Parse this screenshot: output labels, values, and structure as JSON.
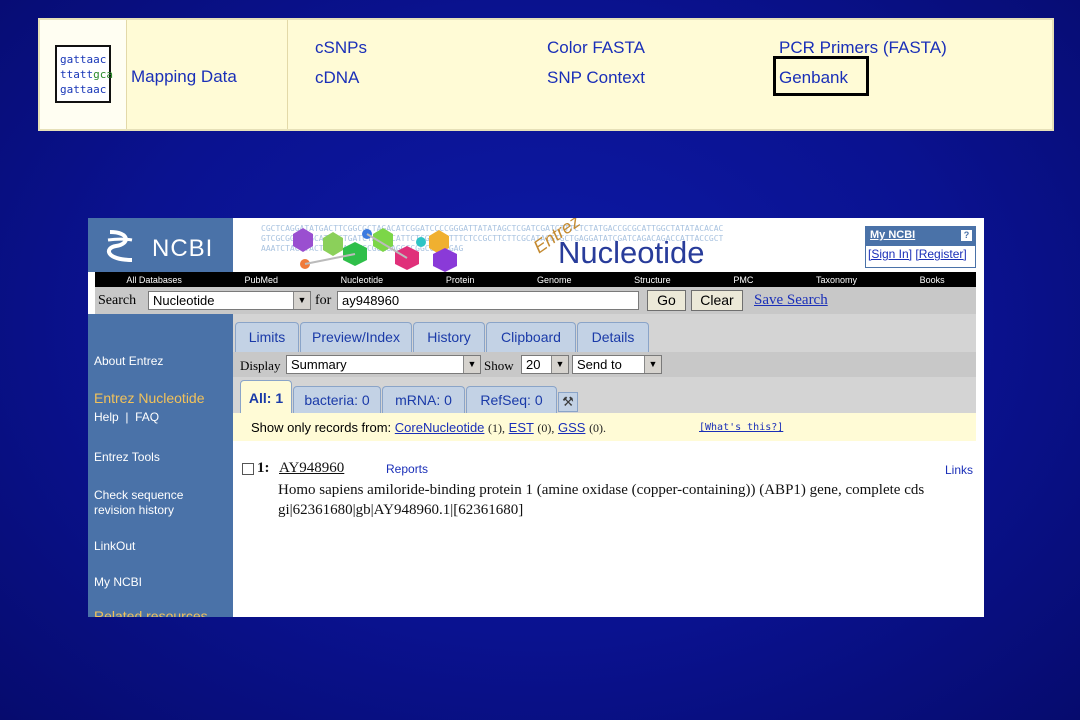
{
  "banner": {
    "logo_lines": [
      [
        "gattaac",
        ""
      ],
      [
        "ttatt",
        "gca"
      ],
      [
        "gattaac",
        ""
      ]
    ],
    "mapping_label": "Mapping Data",
    "links": {
      "col1": [
        "cSNPs",
        "cDNA"
      ],
      "col2": [
        "Color FASTA",
        "SNP Context"
      ],
      "col3": [
        "PCR Primers (FASTA)",
        "Genbank"
      ]
    },
    "highlighted": "Genbank"
  },
  "ncbi": {
    "logo": "NCBI",
    "entrez": "Entrez",
    "title": "Nucleotide",
    "sequence_text": "CGCTCAGGATATGACTTCGGCGCTAGACATCGGATCCCCGGGATTATATAGCTCGATCGATCTTTCTCTATGACCGCGCATTGGCTATATACACACAGTCGCGGATAGCATCACTGATCTACCCCATTCTCGAGAGTTTCTCCGCTTCTTCGCATACGTGCTGAGGATATCGATCAGACAGACCATTACCGCTGAAATCTACTTACTAACCAATTGCGGAGAGGGCGGCGATCGAG",
    "myncbi": {
      "title": "My NCBI",
      "help": "?",
      "sign_in": "[Sign In]",
      "register": "[Register]"
    },
    "db_bar": [
      "All Databases",
      "PubMed",
      "Nucleotide",
      "Protein",
      "Genome",
      "Structure",
      "PMC",
      "Taxonomy",
      "Books"
    ],
    "search": {
      "label": "Search",
      "db_value": "Nucleotide",
      "for_label": "for",
      "query": "ay948960",
      "go": "Go",
      "clear": "Clear",
      "save": "Save Search"
    },
    "nav": {
      "about": "About Entrez",
      "entrez_nucleotide": "Entrez Nucleotide",
      "help_faq": "Help  |  FAQ",
      "tools": "Entrez Tools",
      "check_seq_1": "Check sequence",
      "check_seq_2": "revision history",
      "linkout": "LinkOut",
      "myncbi": "My NCBI",
      "related": "Related resources"
    },
    "tabs": [
      "Limits",
      "Preview/Index",
      "History",
      "Clipboard",
      "Details"
    ],
    "display": {
      "label": "Display",
      "value": "Summary",
      "show_label": "Show",
      "show_value": "20",
      "send_to": "Send to"
    },
    "result_tabs": [
      "All: 1",
      "bacteria: 0",
      "mRNA: 0",
      "RefSeq: 0"
    ],
    "filter": {
      "prefix": "Show only records from:",
      "core": "CoreNucleotide",
      "core_count": "(1),",
      "est": "EST",
      "est_count": "(0),",
      "gss": "GSS",
      "gss_count": "(0).",
      "whats_this": "[What's this?]"
    },
    "result": {
      "number": "1:",
      "accession": "AY948960",
      "reports": "Reports",
      "links": "Links",
      "description": "Homo sapiens amiloride-binding protein 1 (amine oxidase (copper-containing)) (ABP1) gene, complete cds",
      "ids": "gi|62361680|gb|AY948960.1|[62361680]"
    }
  }
}
